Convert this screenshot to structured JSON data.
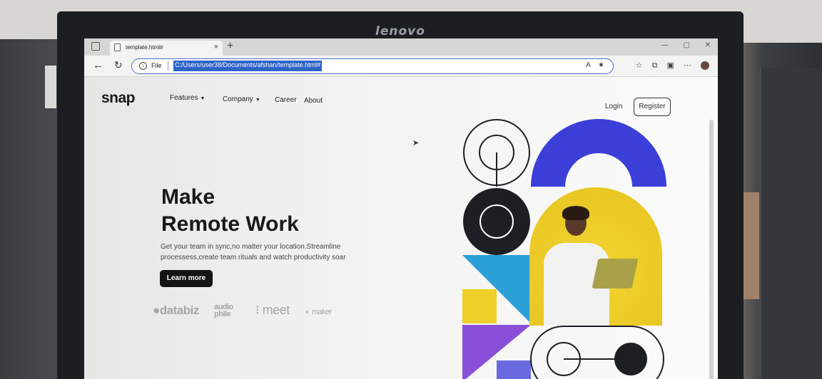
{
  "monitor": {
    "brand": "lenovo"
  },
  "browser": {
    "tab_title": "template.html#",
    "tab_close": "×",
    "new_tab": "+",
    "window_controls": "— ▢ ✕",
    "back": "←",
    "reload": "↻",
    "info": "i",
    "file_label": "File",
    "url": "C:/Users/user38/Documents/afshan/template.html#",
    "address_icons": "A ★",
    "toolbar_icons": "☆ ⧉ ▣ ⋯"
  },
  "page": {
    "logo": "snap",
    "nav": {
      "features": "Features",
      "company": "Company",
      "career": "Career",
      "about": "About",
      "caret": "▼",
      "login": "Login",
      "register": "Register"
    },
    "hero": {
      "title_line1": "Make",
      "title_line2": "Remote Work",
      "subtitle": "Get your team in sync,no matter your location.Streamline processess,create team rituals and watch productivity soar",
      "cta": "Learn more"
    },
    "clients": {
      "databiz": "databiz",
      "audiophile_1": "audio",
      "audiophile_2": "phile",
      "meet": "meet",
      "maker": "maker"
    }
  },
  "colors": {
    "accent_blue": "#3b3fd8",
    "accent_yellow": "#efcf2a",
    "accent_cyan": "#2a9fd8",
    "accent_purple": "#8a4fd8",
    "dark": "#1c1f24",
    "url_highlight": "#2d63c8"
  },
  "icons": {
    "cursor": "pointer-arrow-icon",
    "profile": "profile-avatar-icon"
  }
}
